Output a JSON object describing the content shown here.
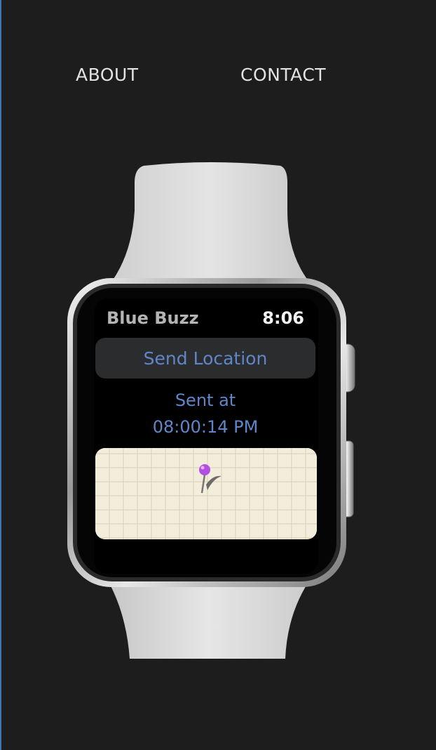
{
  "nav": {
    "about": "ABOUT",
    "contact": "CONTACT"
  },
  "watch_app": {
    "title": "Blue Buzz",
    "time": "8:06",
    "send_button_label": "Send Location",
    "sent_label": "Sent at",
    "sent_time": "08:00:14 PM"
  },
  "colors": {
    "background": "#1d1d1d",
    "accent_blue": "#5f86c8",
    "map_pin": "#b04fe0",
    "band": "#d8d8d8"
  },
  "icons": {
    "map_pin": "map-pin-icon"
  }
}
